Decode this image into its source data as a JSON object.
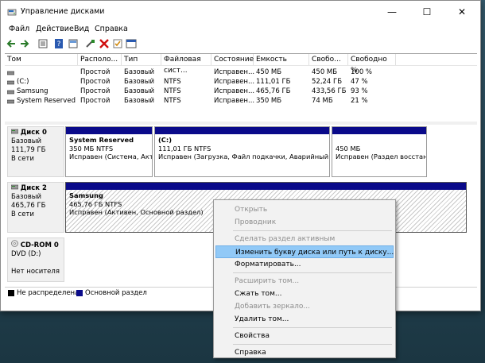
{
  "window": {
    "title": "Управление дисками",
    "controls": {
      "minimize": "—",
      "maximize": "☐",
      "close": "✕"
    }
  },
  "menu": [
    "Файл",
    "Действие",
    "Вид",
    "Справка"
  ],
  "toolbar_icons": [
    "back-icon",
    "forward-icon",
    "properties-icon",
    "help-icon",
    "help-topics-icon",
    "connect-icon",
    "delete-icon",
    "check-icon",
    "window-icon"
  ],
  "volume_list": {
    "columns": [
      "Том",
      "Располо...",
      "Тип",
      "Файловая сист...",
      "Состояние",
      "Емкость",
      "Свобо...",
      "Свободно %"
    ],
    "rows": [
      [
        "",
        "Простой",
        "Базовый",
        "",
        "Исправен...",
        "450 МБ",
        "450 МБ",
        "100 %"
      ],
      [
        "(C:)",
        "Простой",
        "Базовый",
        "NTFS",
        "Исправен...",
        "111,01 ГБ",
        "52,24 ГБ",
        "47 %"
      ],
      [
        "Samsung",
        "Простой",
        "Базовый",
        "NTFS",
        "Исправен...",
        "465,76 ГБ",
        "433,56 ГБ",
        "93 %"
      ],
      [
        "System Reserved",
        "Простой",
        "Базовый",
        "NTFS",
        "Исправен...",
        "350 МБ",
        "74 МБ",
        "21 %"
      ]
    ]
  },
  "disks": [
    {
      "name": "Диск 0",
      "type": "Базовый",
      "size": "111,79 ГБ",
      "status": "В сети",
      "partitions": [
        {
          "name": "System Reserved",
          "size": "350 МБ NTFS",
          "status": "Исправен (Система, Акти"
        },
        {
          "name": "(C:)",
          "size": "111,01 ГБ NTFS",
          "status": "Исправен (Загрузка, Файл подкачки, Аварийный дамп"
        },
        {
          "name": "",
          "size": "450 МБ",
          "status": "Исправен (Раздел восстано"
        }
      ]
    },
    {
      "name": "Диск 2",
      "type": "Базовый",
      "size": "465,76 ГБ",
      "status": "В сети",
      "partitions": [
        {
          "name": "Samsung",
          "size": "465,76 ГБ NTFS",
          "status": "Исправен (Активен, Основной раздел)"
        }
      ]
    },
    {
      "name": "CD-ROM 0",
      "type": "DVD (D:)",
      "size": "",
      "status": "Нет носителя",
      "partitions": []
    }
  ],
  "legend": [
    {
      "label": "Не распределена",
      "color": "#000000"
    },
    {
      "label": "Основной раздел",
      "color": "#0a0a8a"
    }
  ],
  "context_menu": {
    "items": [
      {
        "label": "Открыть",
        "enabled": false
      },
      {
        "label": "Проводник",
        "enabled": false
      },
      {
        "label": "Сделать раздел активным",
        "enabled": false
      },
      {
        "label": "Изменить букву диска или путь к диску...",
        "enabled": true,
        "highlighted": true
      },
      {
        "label": "Форматировать...",
        "enabled": true
      },
      {
        "label": "Расширить том...",
        "enabled": false
      },
      {
        "label": "Сжать том...",
        "enabled": true
      },
      {
        "label": "Добавить зеркало...",
        "enabled": false
      },
      {
        "label": "Удалить том...",
        "enabled": true
      },
      {
        "label": "Свойства",
        "enabled": true
      },
      {
        "label": "Справка",
        "enabled": true
      }
    ]
  },
  "colors": {
    "accent": "#0a0a8a",
    "highlight": "#91c9f7",
    "desktop": "#2e4f5f"
  }
}
